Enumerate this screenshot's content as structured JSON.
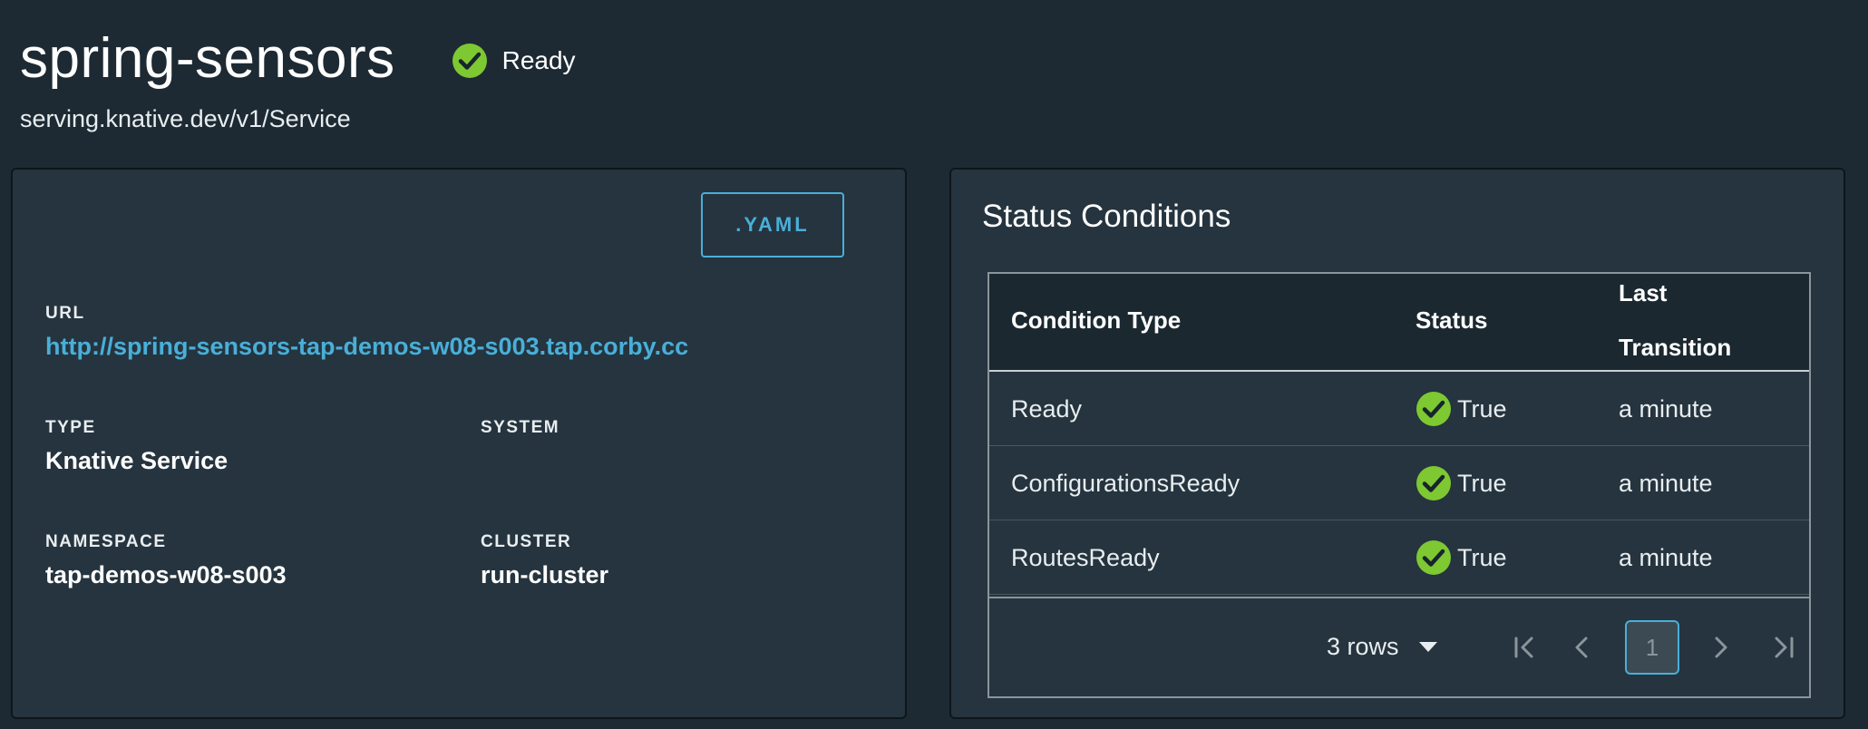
{
  "header": {
    "title": "spring-sensors",
    "status_label": "Ready",
    "subtitle": "serving.knative.dev/v1/Service"
  },
  "overview": {
    "yaml_button": ".YAML",
    "url_label": "URL",
    "url_value": "http://spring-sensors-tap-demos-w08-s003.tap.corby.cc",
    "type_label": "TYPE",
    "type_value": "Knative Service",
    "system_label": "SYSTEM",
    "system_value": "",
    "namespace_label": "NAMESPACE",
    "namespace_value": "tap-demos-w08-s003",
    "cluster_label": "CLUSTER",
    "cluster_value": "run-cluster"
  },
  "conditions": {
    "title": "Status Conditions",
    "columns": [
      "Condition Type",
      "Status",
      "Last",
      "Transition"
    ],
    "rows": [
      {
        "type": "Ready",
        "status": "True",
        "last_transition": "a minute"
      },
      {
        "type": "ConfigurationsReady",
        "status": "True",
        "last_transition": "a minute"
      },
      {
        "type": "RoutesReady",
        "status": "True",
        "last_transition": "a minute"
      }
    ],
    "page_size": "3 rows",
    "current_page": "1"
  },
  "colors": {
    "background": "#1d2a33",
    "card": "#25343e",
    "accent": "#49afd9",
    "success": "#7ec832"
  },
  "icons": {
    "status": "check-circle-icon",
    "pager_first": "first-page-icon",
    "pager_prev": "chevron-left-icon",
    "pager_next": "chevron-right-icon",
    "pager_last": "last-page-icon",
    "dropdown": "caret-down-icon"
  }
}
